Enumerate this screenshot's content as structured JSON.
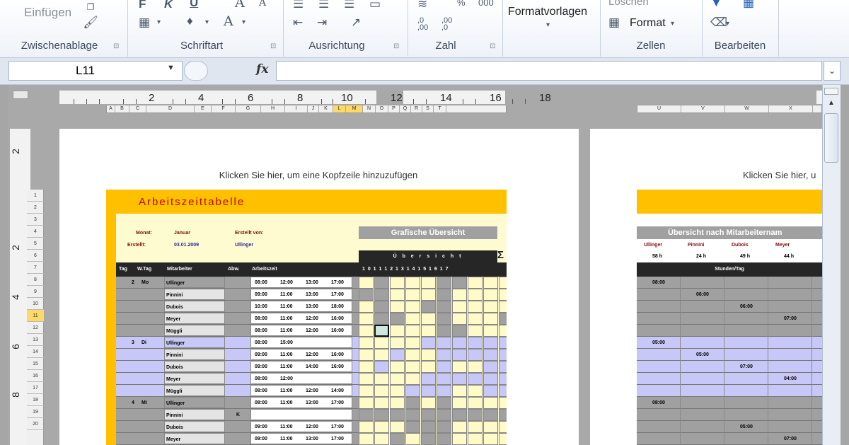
{
  "ribbon": {
    "clipboard": {
      "paste_label": "Einfügen",
      "group_title": "Zwischenablage"
    },
    "font": {
      "bold": "F",
      "italic": "K",
      "underline": "U",
      "grow": "A",
      "shrink": "A",
      "group_title": "Schriftart"
    },
    "alignment": {
      "group_title": "Ausrichtung"
    },
    "number": {
      "percent": "%",
      "thousands": "000",
      "inc_decimal": ",0\n,00",
      "dec_decimal": ",00\n,0",
      "group_title": "Zahl"
    },
    "styles": {
      "label": "Formatvorlagen"
    },
    "cells": {
      "delete_label": "Löschen",
      "format_label": "Format",
      "group_title": "Zellen"
    },
    "editing": {
      "group_title": "Bearbeiten"
    }
  },
  "formula_bar": {
    "name_box": "L11",
    "fx": "fx",
    "formula": ""
  },
  "ruler": {
    "numbers": [
      {
        "label": "2"
      },
      {
        "label": "4"
      },
      {
        "label": "6"
      },
      {
        "label": "8"
      },
      {
        "label": "10"
      },
      {
        "label": "12"
      },
      {
        "label": "14"
      },
      {
        "label": "16"
      },
      {
        "label": "18"
      }
    ],
    "vertical": [
      "2",
      "2",
      "4",
      "6",
      "8"
    ]
  },
  "columns": [
    "A",
    "B",
    "C",
    "D",
    "E",
    "F",
    "G",
    "H",
    "I",
    "J",
    "K",
    "L",
    "M",
    "N",
    "O",
    "P",
    "Q",
    "R",
    "S",
    "T"
  ],
  "columns2": [
    "U",
    "V",
    "W",
    "X"
  ],
  "rows": [
    "1",
    "2",
    "3",
    "4",
    "5",
    "6",
    "7",
    "8",
    "9",
    "10",
    "11",
    "12",
    "13",
    "14",
    "15",
    "16",
    "17",
    "18",
    "19",
    "20"
  ],
  "page1": {
    "header_hint": "Klicken Sie hier, um eine Kopfzeile hinzuzufügen",
    "title": "Arbeitszeittabelle",
    "meta": {
      "monat_label": "Monat:",
      "monat_value": "Januar",
      "erstellt_von_label": "Erstellt von:",
      "erstellt_von_value": "Ullinger",
      "erstellt_label": "Erstellt:",
      "erstellt_value": "03.01.2009"
    },
    "grafik_title": "Grafische Übersicht",
    "uebersicht": "Ü b e r s i c h t",
    "sigma": "Σ",
    "hour_labels": "1 0  1 1  1 2  1 3  1 4  1 5  1 6  1 7",
    "headers": {
      "tag": "Tag",
      "wtag": "W.Tag",
      "mitarbeiter": "Mitarbeiter",
      "abw": "Abw.",
      "arbeitszeit": "Arbeitszeit"
    },
    "rows": [
      {
        "tag": "2",
        "wtag": "Mo",
        "name": "Ullinger",
        "abw": "",
        "t": [
          "08:00",
          "12:00",
          "13:00",
          "17:00"
        ]
      },
      {
        "tag": "",
        "wtag": "",
        "name": "Pinnini",
        "abw": "",
        "t": [
          "09:00",
          "11:00",
          "13:00",
          "17:00"
        ]
      },
      {
        "tag": "",
        "wtag": "",
        "name": "Dubois",
        "abw": "",
        "t": [
          "10:00",
          "11:00",
          "13:00",
          "18:00"
        ]
      },
      {
        "tag": "",
        "wtag": "",
        "name": "Meyer",
        "abw": "",
        "t": [
          "08:00",
          "11:00",
          "12:00",
          "16:00"
        ]
      },
      {
        "tag": "",
        "wtag": "",
        "name": "Müggli",
        "abw": "",
        "t": [
          "08:00",
          "11:00",
          "12:00",
          "16:00"
        ]
      },
      {
        "tag": "3",
        "wtag": "Di",
        "name": "Ullinger",
        "abw": "",
        "t": [
          "08:00",
          "15:00",
          "",
          ""
        ]
      },
      {
        "tag": "",
        "wtag": "",
        "name": "Pinnini",
        "abw": "",
        "t": [
          "09:00",
          "11:00",
          "12:00",
          "16:00"
        ]
      },
      {
        "tag": "",
        "wtag": "",
        "name": "Dubois",
        "abw": "",
        "t": [
          "09:00",
          "11:00",
          "14:00",
          "16:00"
        ]
      },
      {
        "tag": "",
        "wtag": "",
        "name": "Meyer",
        "abw": "",
        "t": [
          "08:00",
          "12:00",
          "",
          ""
        ]
      },
      {
        "tag": "",
        "wtag": "",
        "name": "Müggli",
        "abw": "",
        "t": [
          "08:00",
          "11:00",
          "12:00",
          "14:00"
        ]
      },
      {
        "tag": "4",
        "wtag": "Mi",
        "name": "Ullinger",
        "abw": "",
        "t": [
          "08:00",
          "11:00",
          "13:00",
          "17:00"
        ]
      },
      {
        "tag": "",
        "wtag": "",
        "name": "Pinnini",
        "abw": "K",
        "t": [
          "",
          "",
          "",
          ""
        ]
      },
      {
        "tag": "",
        "wtag": "",
        "name": "Dubois",
        "abw": "",
        "t": [
          "09:00",
          "11:00",
          "12:00",
          "17:00"
        ]
      },
      {
        "tag": "",
        "wtag": "",
        "name": "Meyer",
        "abw": "",
        "t": [
          "09:00",
          "11:00",
          "13:00",
          "17:00"
        ]
      }
    ]
  },
  "page2": {
    "header_hint": "Klicken Sie hier, u",
    "title": "Übersicht nach Mitarbeiternam",
    "names": [
      "Ullinger",
      "Pinnini",
      "Dubois",
      "Meyer"
    ],
    "hours": [
      "58 h",
      "24 h",
      "49 h",
      "44 h"
    ],
    "stunden": "Stunden/Tag",
    "cells": [
      {
        "col": 0,
        "text": "08:00"
      },
      {
        "col": 1,
        "text": "06:00"
      },
      {
        "col": 2,
        "text": "06:00"
      },
      {
        "col": 3,
        "text": "07:00"
      },
      {
        "col": -1,
        "text": ""
      },
      {
        "col": 0,
        "text": "05:00"
      },
      {
        "col": 1,
        "text": "05:00"
      },
      {
        "col": 2,
        "text": "07:00"
      },
      {
        "col": 3,
        "text": "04:00"
      },
      {
        "col": -1,
        "text": ""
      },
      {
        "col": 0,
        "text": "08:00"
      },
      {
        "col": -1,
        "text": ""
      },
      {
        "col": 2,
        "text": "05:00"
      },
      {
        "col": 3,
        "text": "07:00"
      }
    ]
  },
  "colors": {
    "title_bar": "#ffc000",
    "title_text": "#c00000",
    "grey_band": "#a0a0a0",
    "blue_band": "#c8c8f8"
  }
}
